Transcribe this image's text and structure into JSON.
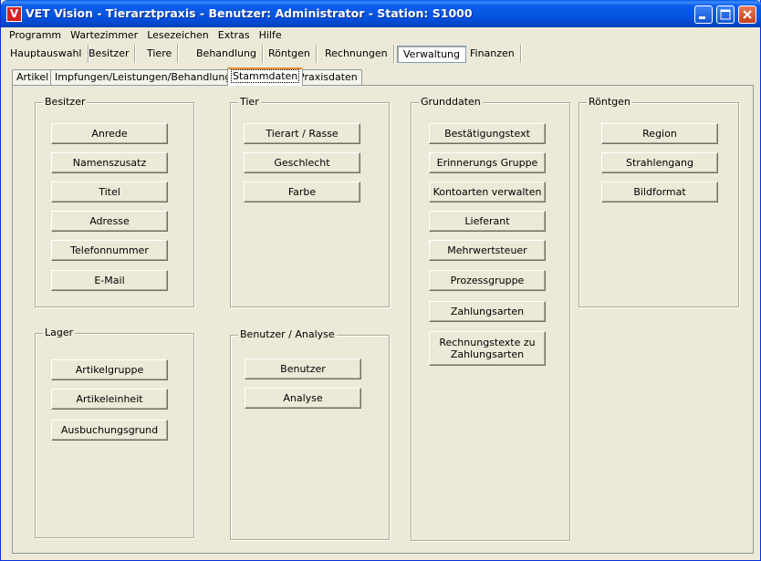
{
  "window": {
    "title": "VET Vision - Tierarztpraxis - Benutzer: Administrator - Station: S1000",
    "icon_letter": "V"
  },
  "menu": [
    "Programm",
    "Wartezimmer",
    "Lesezeichen",
    "Extras",
    "Hilfe"
  ],
  "main_tabs": [
    "Hauptauswahl",
    "Besitzer",
    "Tiere",
    "Behandlung",
    "Röntgen",
    "Rechnungen",
    "Verwaltung",
    "Finanzen"
  ],
  "main_tab_active": "Verwaltung",
  "sub_tabs": [
    "Artikel",
    "Impfungen/Leistungen/Behandlungen",
    "Stammdaten",
    "Praxisdaten"
  ],
  "sub_tab_active": "Stammdaten",
  "groups": {
    "besitzer": {
      "title": "Besitzer",
      "buttons": [
        "Anrede",
        "Namenszusatz",
        "Titel",
        "Adresse",
        "Telefonnummer",
        "E-Mail"
      ]
    },
    "tier": {
      "title": "Tier",
      "buttons": [
        "Tierart / Rasse",
        "Geschlecht",
        "Farbe"
      ]
    },
    "grunddaten": {
      "title": "Grunddaten",
      "buttons": [
        "Bestätigungstext",
        "Erinnerungs Gruppe",
        "Kontoarten verwalten",
        "Lieferant",
        "Mehrwertsteuer",
        "Prozessgruppe",
        "Zahlungsarten",
        "Rechnungstexte zu Zahlungsarten"
      ]
    },
    "roentgen": {
      "title": "Röntgen",
      "buttons": [
        "Region",
        "Strahlengang",
        "Bildformat"
      ]
    },
    "lager": {
      "title": "Lager",
      "buttons": [
        "Artikelgruppe",
        "Artikeleinheit",
        "Ausbuchungsgrund"
      ]
    },
    "benutzer_analyse": {
      "title": "Benutzer / Analyse",
      "buttons": [
        "Benutzer",
        "Analyse"
      ]
    }
  }
}
